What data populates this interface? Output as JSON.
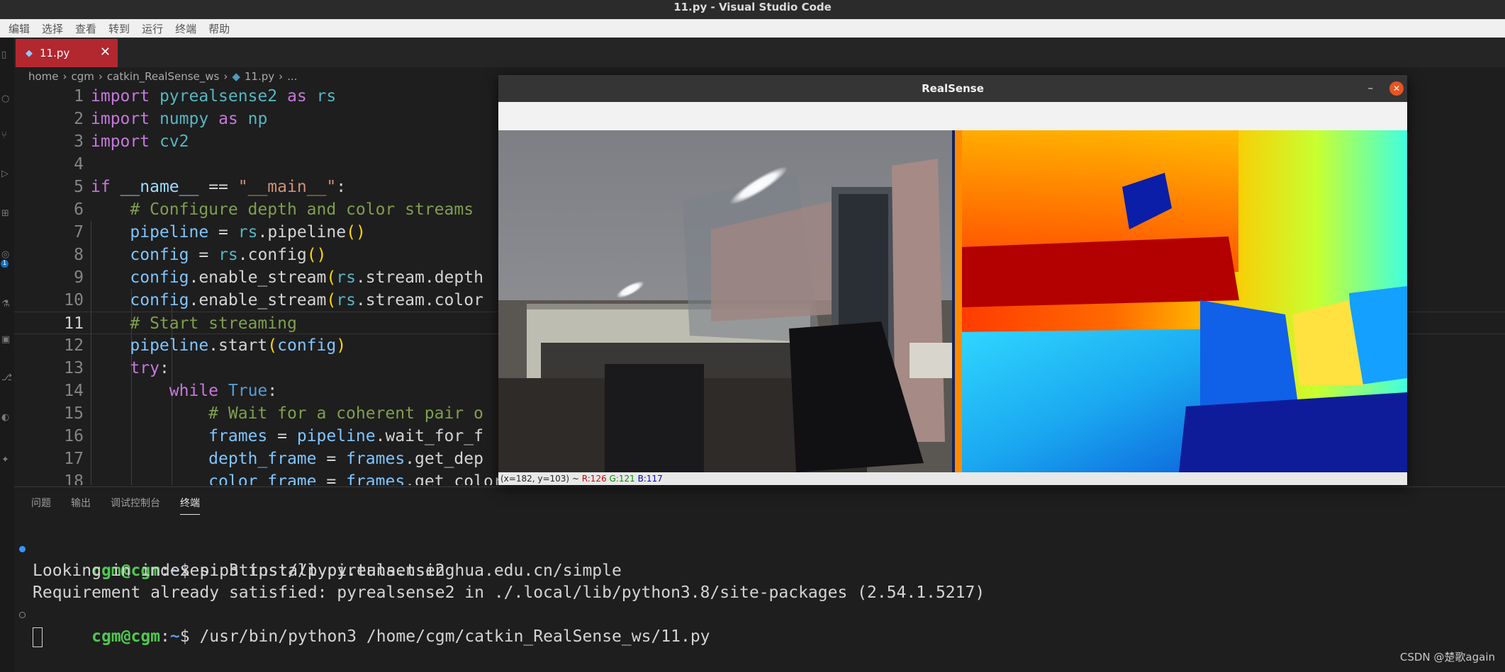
{
  "window": {
    "title": "11.py - Visual Studio Code"
  },
  "menu": [
    "编辑",
    "选择",
    "查看",
    "转到",
    "运行",
    "终端",
    "帮助"
  ],
  "activity_bar": {
    "badge": "1"
  },
  "tab": {
    "label": "11.py",
    "close": "✕"
  },
  "breadcrumb": [
    "home",
    "cgm",
    "catkin_RealSense_ws",
    "11.py",
    "..."
  ],
  "editor": {
    "active_line": 11,
    "line_numbers": [
      "1",
      "2",
      "3",
      "4",
      "5",
      "6",
      "7",
      "8",
      "9",
      "10",
      "11",
      "12",
      "13",
      "14",
      "15",
      "16",
      "17",
      "18"
    ]
  },
  "panel": {
    "tabs": [
      "问题",
      "输出",
      "调试控制台",
      "终端"
    ],
    "active_tab": "终端"
  },
  "terminal": {
    "prompt_user": "cgm@cgm",
    "prompt_sep": ":",
    "prompt_path": "~",
    "prompt_end": "$",
    "cmd1": " pip3 install pyrealsense2",
    "out1": "Looking in indexes: https://pypi.tuna.tsinghua.edu.cn/simple",
    "out2": "Requirement already satisfied: pyrealsense2 in ./.local/lib/python3.8/site-packages (2.54.1.5217)",
    "cmd2": " /usr/bin/python3 /home/cgm/catkin_RealSense_ws/11.py"
  },
  "realsense": {
    "title": "RealSense",
    "minimize": "–",
    "close": "✕",
    "status_coords": "(x=182, y=103) ~ ",
    "status_r": "R:126",
    "status_g": "G:121",
    "status_b": "B:117"
  },
  "watermark": "CSDN @楚歌again",
  "colors": {
    "accent_tab": "#b3272f",
    "ubuntu_close": "#e95420",
    "terminal_user": "#4ec94e"
  }
}
